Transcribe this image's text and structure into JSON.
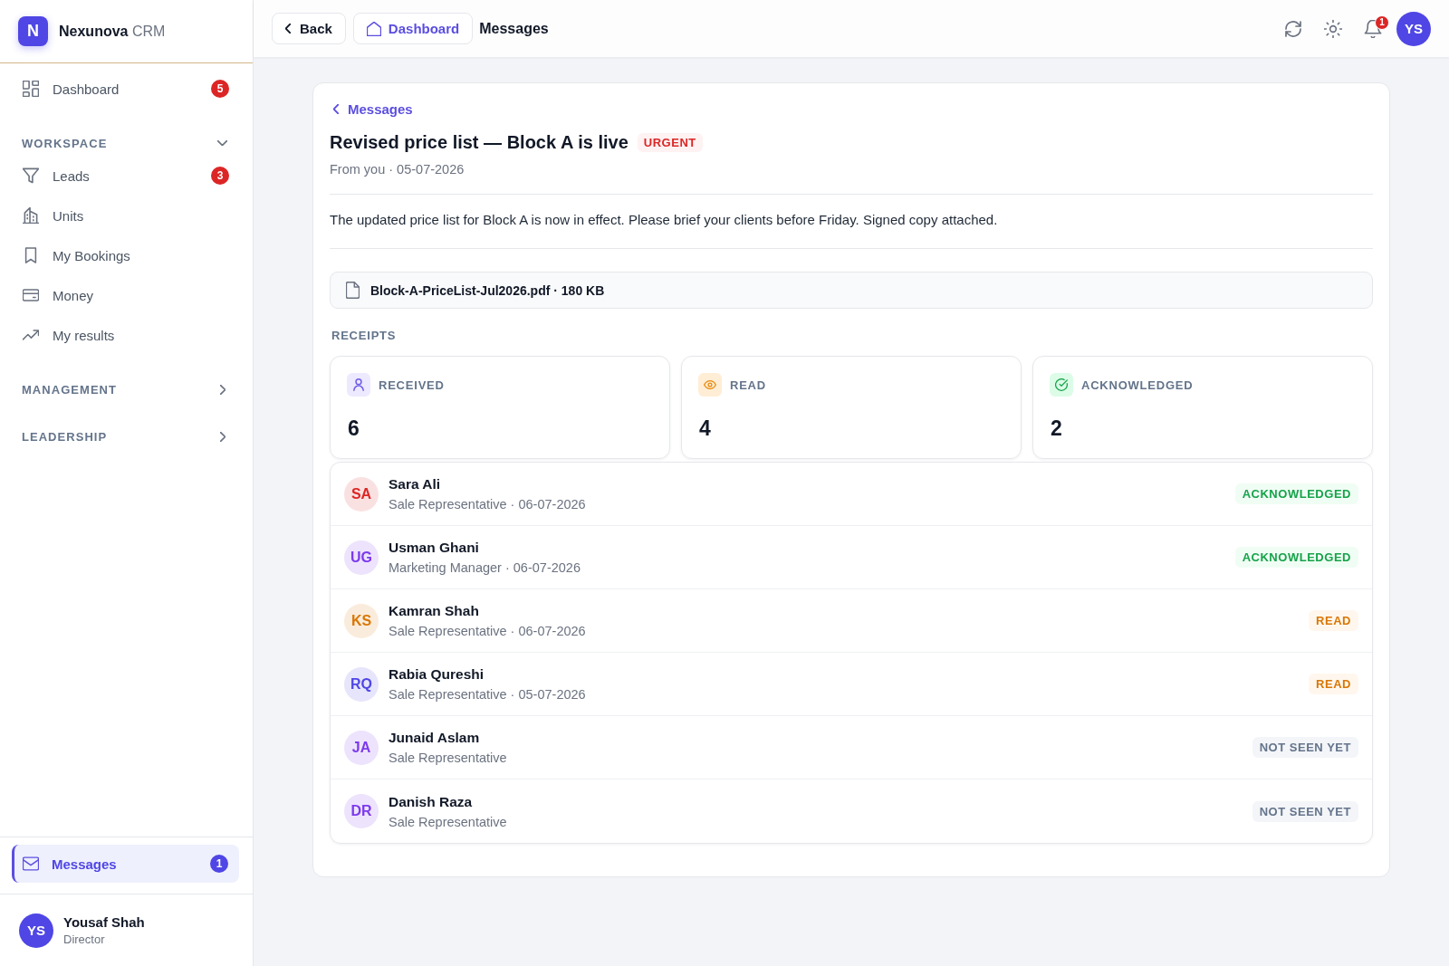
{
  "sidebar": {
    "brand": {
      "logo_letter": "N",
      "name": "**Nexunova** CRM"
    },
    "items": [
      {
        "label": "Dashboard",
        "badge": "5",
        "selected": false
      }
    ],
    "groups": [
      {
        "label": "WORKSPACE",
        "expanded": true,
        "items": [
          {
            "label": "Leads",
            "badge": "3",
            "selected": false
          },
          {
            "label": "Units",
            "selected": false
          },
          {
            "label": "My Bookings",
            "selected": false
          },
          {
            "label": "Money",
            "selected": false
          },
          {
            "label": "My results",
            "selected": false
          }
        ]
      },
      {
        "label": "MANAGEMENT",
        "expanded": false
      },
      {
        "label": "LEADERSHIP",
        "expanded": false
      }
    ],
    "footer_items": [
      {
        "label": "Messages",
        "badge": "1",
        "selected": true
      }
    ],
    "user": {
      "initials": "YS",
      "name": "Yousaf Shah",
      "role": "Director"
    }
  },
  "topbar": {
    "back_button": "Back",
    "breadcrumb": "Dashboard",
    "page_title": "Messages",
    "notification_count": "1",
    "user_initials": "YS"
  },
  "message": {
    "back_link": "Messages",
    "title": "Revised price list — Block A is live",
    "priority": "URGENT",
    "meta": "From you · 05-07-2026",
    "body": "The updated price list for Block A is now in effect. Please brief your clients before Friday. Signed copy attached.",
    "attachment": "Block-A-PriceList-Jul2026.pdf · 180 KB",
    "receipts": {
      "heading": "RECEIPTS",
      "stats": [
        {
          "kind": "received",
          "label": "RECEIVED",
          "value": "6"
        },
        {
          "kind": "read",
          "label": "READ",
          "value": "4"
        },
        {
          "kind": "acknowledged",
          "label": "ACKNOWLEDGED",
          "value": "2"
        }
      ]
    },
    "recipients": [
      {
        "initials": "SA",
        "name": "Sara Ali",
        "details": "Sale Representative · 06-07-2026",
        "color": "#dc2626",
        "status": {
          "kind": "acknowledged",
          "label": "ACKNOWLEDGED"
        }
      },
      {
        "initials": "UG",
        "name": "Usman Ghani",
        "details": "Marketing Manager · 06-07-2026",
        "color": "#7c3aed",
        "status": {
          "kind": "acknowledged",
          "label": "ACKNOWLEDGED"
        }
      },
      {
        "initials": "KS",
        "name": "Kamran Shah",
        "details": "Sale Representative · 06-07-2026",
        "color": "#d97706",
        "status": {
          "kind": "read",
          "label": "READ"
        }
      },
      {
        "initials": "RQ",
        "name": "Rabia Qureshi",
        "details": "Sale Representative · 05-07-2026",
        "color": "#4f46e5",
        "status": {
          "kind": "read",
          "label": "READ"
        }
      },
      {
        "initials": "JA",
        "name": "Junaid Aslam",
        "details": "Sale Representative",
        "color": "#7c3aed",
        "status": {
          "kind": "not_seen",
          "label": "NOT SEEN YET"
        }
      },
      {
        "initials": "DR",
        "name": "Danish Raza",
        "details": "Sale Representative",
        "color": "#7c3aed",
        "status": {
          "kind": "not_seen",
          "label": "NOT SEEN YET"
        }
      }
    ]
  }
}
